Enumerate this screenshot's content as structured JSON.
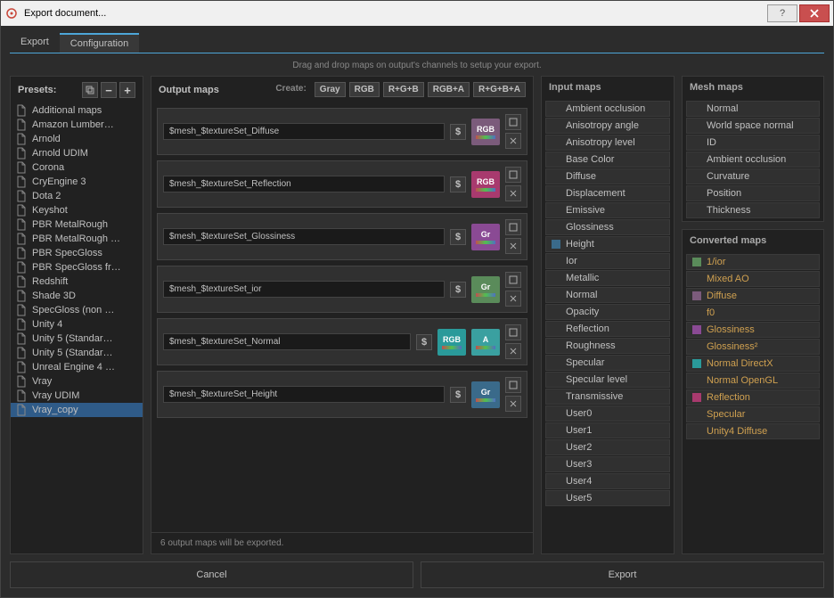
{
  "window": {
    "title": "Export document..."
  },
  "tabs": {
    "export": "Export",
    "config": "Configuration"
  },
  "hint": "Drag and drop maps on output's channels to setup your export.",
  "presets_label": "Presets:",
  "presets": [
    "Additional maps",
    "Amazon Lumber…",
    "Arnold",
    "Arnold UDIM",
    "Corona",
    "CryEngine 3",
    "Dota 2",
    "Keyshot",
    "PBR MetalRough",
    "PBR MetalRough …",
    "PBR SpecGloss",
    "PBR SpecGloss fr…",
    "Redshift",
    "Shade 3D",
    "SpecGloss (non …",
    "Unity 4",
    "Unity 5 (Standar…",
    "Unity 5 (Standar…",
    "Unreal Engine 4 …",
    "Vray",
    "Vray UDIM",
    "Vray_copy"
  ],
  "output": {
    "title": "Output maps",
    "create_label": "Create:",
    "create_btns": [
      "Gray",
      "RGB",
      "R+G+B",
      "RGB+A",
      "R+G+B+A"
    ],
    "rows": [
      {
        "name": "$mesh_$textureSet_Diffuse",
        "channels": [
          {
            "label": "RGB",
            "color": "#7b5b7b"
          }
        ]
      },
      {
        "name": "$mesh_$textureSet_Reflection",
        "channels": [
          {
            "label": "RGB",
            "color": "#a83a6e"
          }
        ]
      },
      {
        "name": "$mesh_$textureSet_Glossiness",
        "channels": [
          {
            "label": "Gr",
            "color": "#8a4a94"
          }
        ]
      },
      {
        "name": "$mesh_$textureSet_ior",
        "channels": [
          {
            "label": "Gr",
            "color": "#5a8b5a"
          }
        ]
      },
      {
        "name": "$mesh_$textureSet_Normal",
        "channels": [
          {
            "label": "RGB",
            "color": "#2a9a9a"
          },
          {
            "label": "A",
            "color": "#3aa0a0"
          }
        ]
      },
      {
        "name": "$mesh_$textureSet_Height",
        "channels": [
          {
            "label": "Gr",
            "color": "#3a6a8a"
          }
        ]
      }
    ],
    "status": "6 output maps will be exported."
  },
  "input": {
    "title": "Input maps",
    "items": [
      "Ambient occlusion",
      "Anisotropy angle",
      "Anisotropy level",
      "Base Color",
      "Diffuse",
      "Displacement",
      "Emissive",
      "Glossiness",
      "Height",
      "Ior",
      "Metallic",
      "Normal",
      "Opacity",
      "Reflection",
      "Roughness",
      "Specular",
      "Specular level",
      "Transmissive",
      "User0",
      "User1",
      "User2",
      "User3",
      "User4",
      "User5"
    ]
  },
  "mesh": {
    "title": "Mesh maps",
    "items": [
      "Normal",
      "World space normal",
      "ID",
      "Ambient occlusion",
      "Curvature",
      "Position",
      "Thickness"
    ]
  },
  "converted": {
    "title": "Converted maps",
    "items": [
      {
        "label": "1/ior",
        "color": "#5a8b5a"
      },
      {
        "label": "Mixed AO",
        "color": ""
      },
      {
        "label": "Diffuse",
        "color": "#7b5b7b"
      },
      {
        "label": "f0",
        "color": ""
      },
      {
        "label": "Glossiness",
        "color": "#8a4a94"
      },
      {
        "label": "Glossiness²",
        "color": ""
      },
      {
        "label": "Normal DirectX",
        "color": "#2a9a9a"
      },
      {
        "label": "Normal OpenGL",
        "color": ""
      },
      {
        "label": "Reflection",
        "color": "#a83a6e"
      },
      {
        "label": "Specular",
        "color": ""
      },
      {
        "label": "Unity4 Diffuse",
        "color": ""
      }
    ]
  },
  "footer": {
    "cancel": "Cancel",
    "export": "Export"
  }
}
